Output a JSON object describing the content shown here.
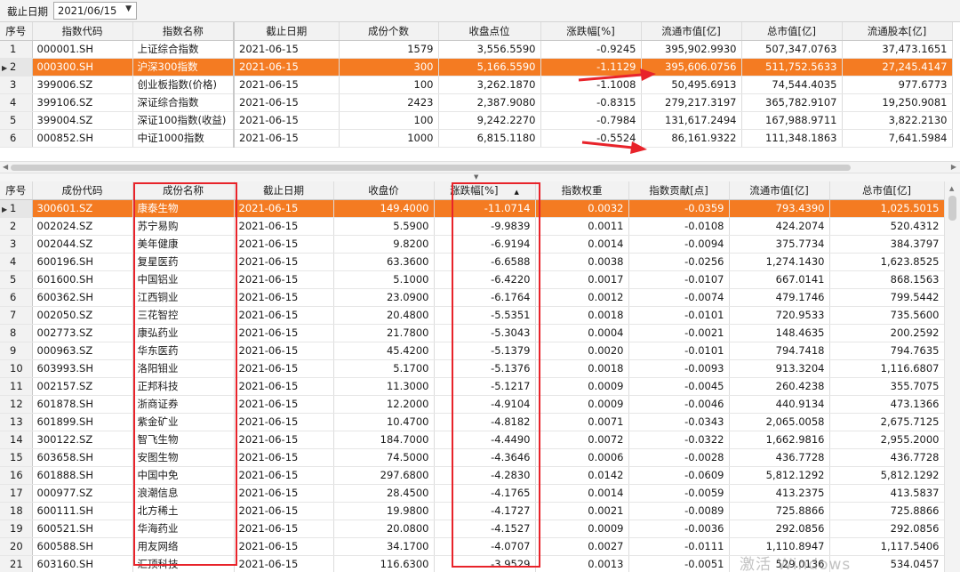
{
  "toolbar": {
    "date_label": "截止日期",
    "date_value": "2021/06/15"
  },
  "top_table": {
    "headers": [
      "序号",
      "指数代码",
      "指数名称",
      "截止日期",
      "成份个数",
      "收盘点位",
      "涨跌幅[%]",
      "流通市值[亿]",
      "总市值[亿]",
      "流通股本[亿]"
    ],
    "rows": [
      [
        "1",
        "000001.SH",
        "上证综合指数",
        "2021-06-15",
        "1579",
        "3,556.5590",
        "-0.9245",
        "395,902.9930",
        "507,347.0763",
        "37,473.1651"
      ],
      [
        "2",
        "000300.SH",
        "沪深300指数",
        "2021-06-15",
        "300",
        "5,166.5590",
        "-1.1129",
        "395,606.0756",
        "511,752.5633",
        "27,245.4147"
      ],
      [
        "3",
        "399006.SZ",
        "创业板指数(价格)",
        "2021-06-15",
        "100",
        "3,262.1870",
        "-1.1008",
        "50,495.6913",
        "74,544.4035",
        "977.6773"
      ],
      [
        "4",
        "399106.SZ",
        "深证综合指数",
        "2021-06-15",
        "2423",
        "2,387.9080",
        "-0.8315",
        "279,217.3197",
        "365,782.9107",
        "19,250.9081"
      ],
      [
        "5",
        "399004.SZ",
        "深证100指数(收益)",
        "2021-06-15",
        "100",
        "9,242.2270",
        "-0.7984",
        "131,617.2494",
        "167,988.9711",
        "3,822.2130"
      ],
      [
        "6",
        "000852.SH",
        "中证1000指数",
        "2021-06-15",
        "1000",
        "6,815.1180",
        "-0.5524",
        "86,161.9322",
        "111,348.1863",
        "7,641.5984"
      ]
    ]
  },
  "bottom_table": {
    "headers": [
      "序号",
      "成份代码",
      "成份名称",
      "截止日期",
      "收盘价",
      "涨跌幅[%]",
      "指数权重",
      "指数贡献[点]",
      "流通市值[亿]",
      "总市值[亿]"
    ],
    "sort_icon": "sort-descending-icon",
    "rows": [
      [
        "1",
        "300601.SZ",
        "康泰生物",
        "2021-06-15",
        "149.4000",
        "-11.0714",
        "0.0032",
        "-0.0359",
        "793.4390",
        "1,025.5015"
      ],
      [
        "2",
        "002024.SZ",
        "苏宁易购",
        "2021-06-15",
        "5.5900",
        "-9.9839",
        "0.0011",
        "-0.0108",
        "424.2074",
        "520.4312"
      ],
      [
        "3",
        "002044.SZ",
        "美年健康",
        "2021-06-15",
        "9.8200",
        "-6.9194",
        "0.0014",
        "-0.0094",
        "375.7734",
        "384.3797"
      ],
      [
        "4",
        "600196.SH",
        "复星医药",
        "2021-06-15",
        "63.3600",
        "-6.6588",
        "0.0038",
        "-0.0256",
        "1,274.1430",
        "1,623.8525"
      ],
      [
        "5",
        "601600.SH",
        "中国铝业",
        "2021-06-15",
        "5.1000",
        "-6.4220",
        "0.0017",
        "-0.0107",
        "667.0141",
        "868.1563"
      ],
      [
        "6",
        "600362.SH",
        "江西铜业",
        "2021-06-15",
        "23.0900",
        "-6.1764",
        "0.0012",
        "-0.0074",
        "479.1746",
        "799.5442"
      ],
      [
        "7",
        "002050.SZ",
        "三花智控",
        "2021-06-15",
        "20.4800",
        "-5.5351",
        "0.0018",
        "-0.0101",
        "720.9533",
        "735.5600"
      ],
      [
        "8",
        "002773.SZ",
        "康弘药业",
        "2021-06-15",
        "21.7800",
        "-5.3043",
        "0.0004",
        "-0.0021",
        "148.4635",
        "200.2592"
      ],
      [
        "9",
        "000963.SZ",
        "华东医药",
        "2021-06-15",
        "45.4200",
        "-5.1379",
        "0.0020",
        "-0.0101",
        "794.7418",
        "794.7635"
      ],
      [
        "10",
        "603993.SH",
        "洛阳钼业",
        "2021-06-15",
        "5.1700",
        "-5.1376",
        "0.0018",
        "-0.0093",
        "913.3204",
        "1,116.6807"
      ],
      [
        "11",
        "002157.SZ",
        "正邦科技",
        "2021-06-15",
        "11.3000",
        "-5.1217",
        "0.0009",
        "-0.0045",
        "260.4238",
        "355.7075"
      ],
      [
        "12",
        "601878.SH",
        "浙商证券",
        "2021-06-15",
        "12.2000",
        "-4.9104",
        "0.0009",
        "-0.0046",
        "440.9134",
        "473.1366"
      ],
      [
        "13",
        "601899.SH",
        "紫金矿业",
        "2021-06-15",
        "10.4700",
        "-4.8182",
        "0.0071",
        "-0.0343",
        "2,065.0058",
        "2,675.7125"
      ],
      [
        "14",
        "300122.SZ",
        "智飞生物",
        "2021-06-15",
        "184.7000",
        "-4.4490",
        "0.0072",
        "-0.0322",
        "1,662.9816",
        "2,955.2000"
      ],
      [
        "15",
        "603658.SH",
        "安图生物",
        "2021-06-15",
        "74.5000",
        "-4.3646",
        "0.0006",
        "-0.0028",
        "436.7728",
        "436.7728"
      ],
      [
        "16",
        "601888.SH",
        "中国中免",
        "2021-06-15",
        "297.6800",
        "-4.2830",
        "0.0142",
        "-0.0609",
        "5,812.1292",
        "5,812.1292"
      ],
      [
        "17",
        "000977.SZ",
        "浪潮信息",
        "2021-06-15",
        "28.4500",
        "-4.1765",
        "0.0014",
        "-0.0059",
        "413.2375",
        "413.5837"
      ],
      [
        "18",
        "600111.SH",
        "北方稀土",
        "2021-06-15",
        "19.9800",
        "-4.1727",
        "0.0021",
        "-0.0089",
        "725.8866",
        "725.8866"
      ],
      [
        "19",
        "600521.SH",
        "华海药业",
        "2021-06-15",
        "20.0800",
        "-4.1527",
        "0.0009",
        "-0.0036",
        "292.0856",
        "292.0856"
      ],
      [
        "20",
        "600588.SH",
        "用友网络",
        "2021-06-15",
        "34.1700",
        "-4.0707",
        "0.0027",
        "-0.0111",
        "1,110.8947",
        "1,117.5406"
      ],
      [
        "21",
        "603160.SH",
        "汇顶科技",
        "2021-06-15",
        "116.6300",
        "-3.9529",
        "0.0013",
        "-0.0051",
        "529.0136",
        "534.0457"
      ]
    ]
  },
  "colors": {
    "selection": "#f47b22",
    "highlight": "#e8232a"
  },
  "watermark": "激活 Windows"
}
